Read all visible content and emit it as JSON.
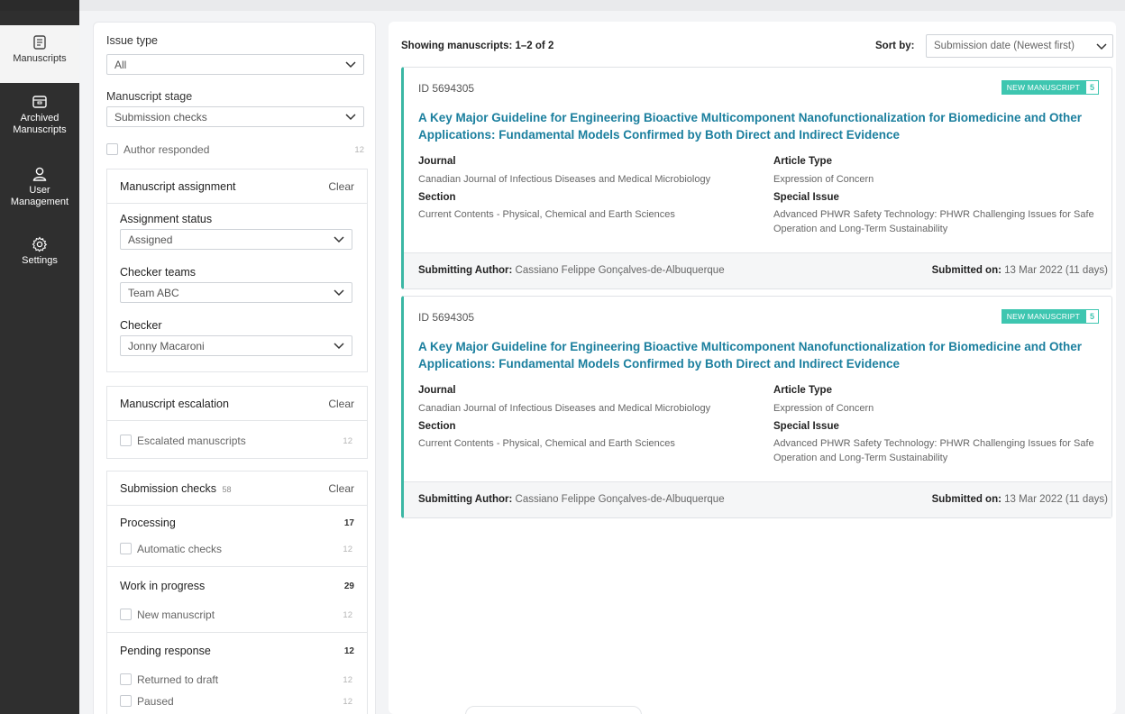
{
  "sidebar": {
    "items": [
      {
        "label": "Manuscripts"
      },
      {
        "label": "Archived Manuscripts"
      },
      {
        "label": "User Management"
      },
      {
        "label": "Settings"
      }
    ]
  },
  "filters": {
    "issue_type": {
      "label": "Issue type",
      "value": "All"
    },
    "manuscript_stage": {
      "label": "Manuscript stage",
      "value": "Submission checks"
    },
    "author_responded": {
      "label": "Author responded",
      "count": "12"
    },
    "assignment": {
      "title": "Manuscript assignment",
      "clear": "Clear",
      "status_label": "Assignment status",
      "status_value": "Assigned",
      "teams_label": "Checker teams",
      "teams_value": "Team ABC",
      "checker_label": "Checker",
      "checker_value": "Jonny Macaroni"
    },
    "escalation": {
      "title": "Manuscript escalation",
      "clear": "Clear",
      "option": "Escalated manuscripts",
      "count": "12"
    },
    "submission_checks": {
      "title": "Submission checks",
      "title_count": "58",
      "clear": "Clear",
      "processing": {
        "label": "Processing",
        "count": "17",
        "opt": "Automatic checks",
        "opt_count": "12"
      },
      "wip": {
        "label": "Work in progress",
        "count": "29",
        "opt": "New manuscript",
        "opt_count": "12"
      },
      "pending": {
        "label": "Pending response",
        "count": "12",
        "opt1": "Returned to draft",
        "opt1_count": "12",
        "opt2": "Paused",
        "opt2_count": "12"
      }
    }
  },
  "results": {
    "showing": "Showing manuscripts: 1–2 of 2",
    "sort_label": "Sort by:",
    "sort_value": "Submission date (Newest first)",
    "labels": {
      "journal": "Journal",
      "article_type": "Article Type",
      "section": "Section",
      "special_issue": "Special Issue",
      "submitting_author": "Submitting Author:",
      "submitted_on": "Submitted on:"
    },
    "cards": [
      {
        "id": "ID 5694305",
        "badge": "NEW MANUSCRIPT",
        "badge_count": "5",
        "title": "A Key Major Guideline for Engineering Bioactive Multicomponent Nanofunctionalization for Biomedicine and Other Applications: Fundamental Models Confirmed by Both Direct and Indirect Evidence",
        "journal": "Canadian Journal of Infectious Diseases and Medical Microbiology",
        "article_type": "Expression of Concern",
        "section": "Current Contents - Physical, Chemical and Earth Sciences",
        "special_issue": "Advanced PHWR Safety Technology: PHWR Challenging Issues for Safe Operation and Long-Term Sustainability",
        "author": "Cassiano Felippe Gonçalves-de-Albuquerque",
        "submitted": "13 Mar 2022 (11 days)"
      },
      {
        "id": "ID 5694305",
        "badge": "NEW MANUSCRIPT",
        "badge_count": "5",
        "title": "A Key Major Guideline for Engineering Bioactive Multicomponent Nanofunctionalization for Biomedicine and Other Applications: Fundamental Models Confirmed by Both Direct and Indirect Evidence",
        "journal": "Canadian Journal of Infectious Diseases and Medical Microbiology",
        "article_type": "Expression of Concern",
        "section": "Current Contents - Physical, Chemical and Earth Sciences",
        "special_issue": "Advanced PHWR Safety Technology: PHWR Challenging Issues for Safe Operation and Long-Term Sustainability",
        "author": "Cassiano Felippe Gonçalves-de-Albuquerque",
        "submitted": "13 Mar 2022 (11 days)"
      }
    ]
  },
  "colors": {
    "accent": "#3bb7a4",
    "link": "#1b7f9e",
    "sidebar": "#2f2f2f"
  },
  "icons": [
    "manuscripts-icon",
    "archive-icon",
    "user-icon",
    "gear-icon",
    "chevron-down-icon"
  ]
}
